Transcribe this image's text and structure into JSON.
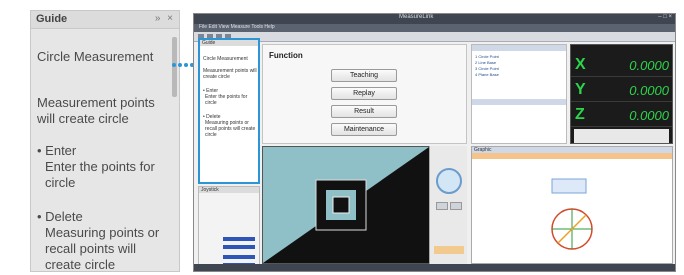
{
  "guide": {
    "title": "Guide",
    "controls": "» ×",
    "heading": "Circle Measurement",
    "description": "Measurement points will create circle",
    "enter_title": "• Enter",
    "enter_desc": "Enter the points for circle",
    "delete_title": "• Delete",
    "delete_desc": "Measuring points or recall points will create circle"
  },
  "window": {
    "title": "MeasureLink",
    "menu": "File  Edit  View  Measure  Tools  Help",
    "controls": "– □ ×",
    "mini_guide": {
      "header": "Guide",
      "heading": "Circle Measurement",
      "description": "Measurement points will create circle",
      "enter": "• Enter",
      "enter_desc": "Enter the points for circle",
      "delete": "• Delete",
      "delete_desc": "Measuring points or recall points will create circle"
    },
    "function_panel": {
      "title": "Function",
      "buttons": [
        "Teaching",
        "Replay",
        "Result",
        "Maintenance"
      ]
    },
    "list_panel": {
      "rows": [
        "1  Circle  Point",
        "2  Line   Base",
        "3  Circle  Point",
        "4  Plane  Base"
      ]
    },
    "dro": {
      "axes": [
        {
          "axis": "X",
          "value": "0.0000"
        },
        {
          "axis": "Y",
          "value": "0.0000"
        },
        {
          "axis": "Z",
          "value": "0.0000"
        }
      ]
    },
    "graphic_panel": {
      "label": "Graphic"
    },
    "joystick": {
      "header": "Joystick"
    }
  },
  "colors": {
    "callout": "#2b95d6",
    "dro_text": "#2dd34a",
    "dro_bg": "#1b1b1b"
  }
}
